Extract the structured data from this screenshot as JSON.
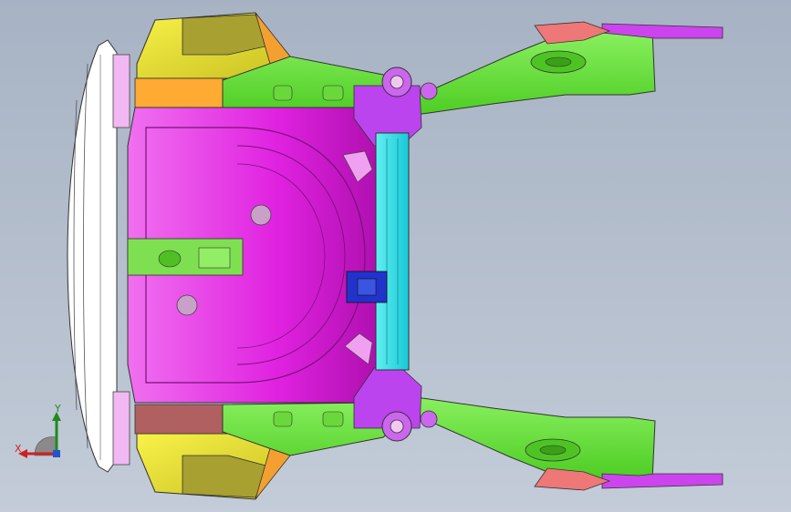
{
  "viewport": {
    "background_top": "#a7b3c4",
    "background_bottom": "#c3ccd8"
  },
  "triad": {
    "x_label": "X",
    "y_label": "Y",
    "x_color": "#cc2222",
    "y_color": "#1f8a1f",
    "z_color": "#2255cc"
  },
  "parts": [
    {
      "name": "rear-bumper-beam",
      "color": "#ffffff"
    },
    {
      "name": "rear-floor-pan",
      "color": "#ee22ee"
    },
    {
      "name": "spare-wheel-well",
      "color": "#dd33dd"
    },
    {
      "name": "left-rear-rail",
      "color": "#66ee33"
    },
    {
      "name": "right-rear-rail",
      "color": "#66ee33"
    },
    {
      "name": "rear-cross-member",
      "color": "#22dddd"
    },
    {
      "name": "left-wheelhouse-panel",
      "color": "#eeee22"
    },
    {
      "name": "right-wheelhouse-panel",
      "color": "#eeee22"
    },
    {
      "name": "center-bracket",
      "color": "#2233cc"
    },
    {
      "name": "left-rear-extension-orange",
      "color": "#ffaa33"
    },
    {
      "name": "right-rear-extension-brown",
      "color": "#b06060"
    },
    {
      "name": "left-side-rail-purple",
      "color": "#cc44ee"
    },
    {
      "name": "right-side-rail-purple",
      "color": "#cc44ee"
    },
    {
      "name": "left-rail-end-red",
      "color": "#ee7777"
    },
    {
      "name": "right-rail-end-red",
      "color": "#ee7777"
    }
  ]
}
